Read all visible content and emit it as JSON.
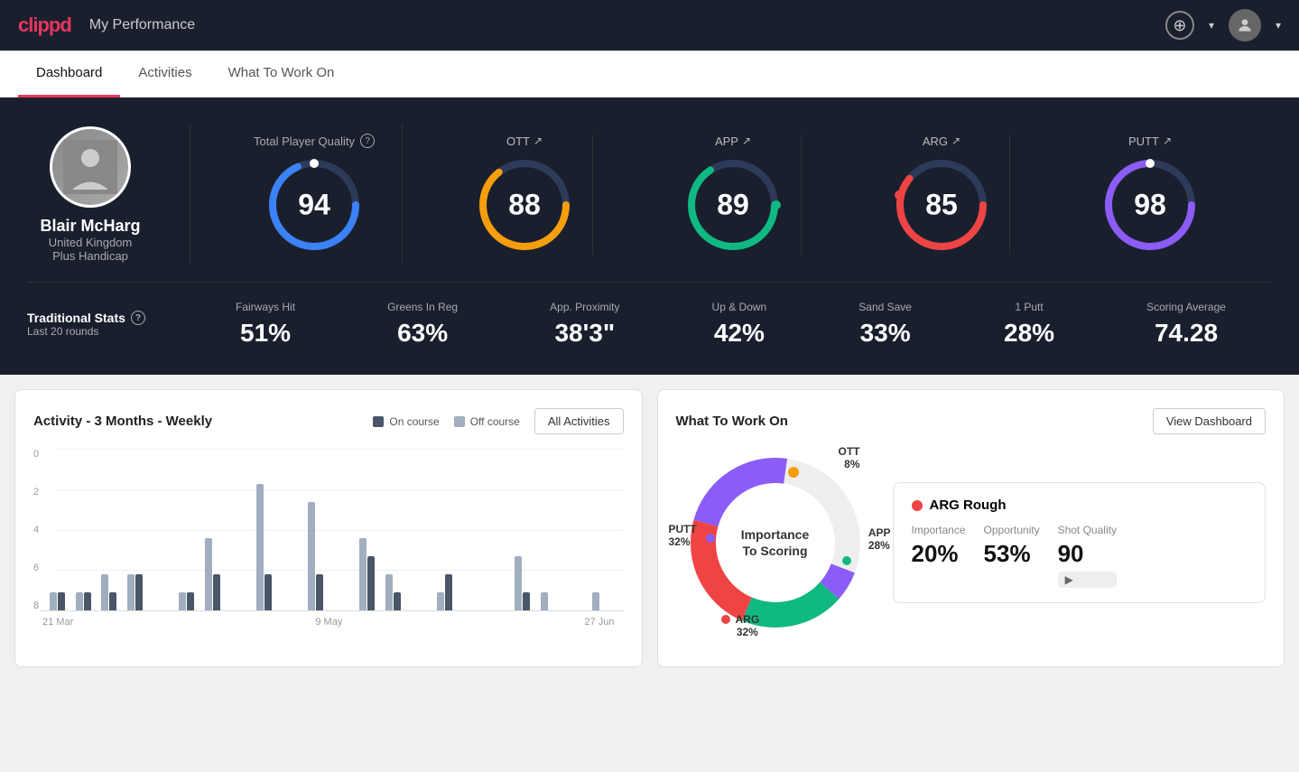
{
  "app": {
    "logo": "clippd",
    "header_title": "My Performance"
  },
  "tabs": [
    {
      "id": "dashboard",
      "label": "Dashboard",
      "active": true
    },
    {
      "id": "activities",
      "label": "Activities",
      "active": false
    },
    {
      "id": "what-to-work-on",
      "label": "What To Work On",
      "active": false
    }
  ],
  "player": {
    "name": "Blair McHarg",
    "country": "United Kingdom",
    "handicap": "Plus Handicap"
  },
  "total_quality": {
    "label": "Total Player Quality",
    "value": 94,
    "color": "#3b82f6"
  },
  "scores": [
    {
      "id": "ott",
      "label": "OTT",
      "value": 88,
      "color": "#f59e0b",
      "trend": "↗"
    },
    {
      "id": "app",
      "label": "APP",
      "value": 89,
      "color": "#10b981",
      "trend": "↗"
    },
    {
      "id": "arg",
      "label": "ARG",
      "value": 85,
      "color": "#ef4444",
      "trend": "↗"
    },
    {
      "id": "putt",
      "label": "PUTT",
      "value": 98,
      "color": "#8b5cf6",
      "trend": "↗"
    }
  ],
  "traditional_stats": {
    "title": "Traditional Stats",
    "period": "Last 20 rounds",
    "stats": [
      {
        "label": "Fairways Hit",
        "value": "51%"
      },
      {
        "label": "Greens In Reg",
        "value": "63%"
      },
      {
        "label": "App. Proximity",
        "value": "38'3\""
      },
      {
        "label": "Up & Down",
        "value": "42%"
      },
      {
        "label": "Sand Save",
        "value": "33%"
      },
      {
        "label": "1 Putt",
        "value": "28%"
      },
      {
        "label": "Scoring Average",
        "value": "74.28"
      }
    ]
  },
  "activity_chart": {
    "title": "Activity - 3 Months - Weekly",
    "legend": [
      {
        "label": "On course",
        "color": "#4a5568"
      },
      {
        "label": "Off course",
        "color": "#a0aec0"
      }
    ],
    "all_activities_btn": "All Activities",
    "y_labels": [
      "0",
      "2",
      "4",
      "6",
      "8"
    ],
    "x_labels": [
      "21 Mar",
      "9 May",
      "27 Jun"
    ],
    "bars": [
      {
        "on": 1,
        "off": 1
      },
      {
        "on": 1,
        "off": 1
      },
      {
        "on": 1,
        "off": 2
      },
      {
        "on": 2,
        "off": 2
      },
      {
        "on": 0,
        "off": 0
      },
      {
        "on": 1,
        "off": 1
      },
      {
        "on": 2,
        "off": 4
      },
      {
        "on": 0,
        "off": 0
      },
      {
        "on": 2,
        "off": 7
      },
      {
        "on": 0,
        "off": 0
      },
      {
        "on": 2,
        "off": 6
      },
      {
        "on": 0,
        "off": 0
      },
      {
        "on": 3,
        "off": 4
      },
      {
        "on": 1,
        "off": 2
      },
      {
        "on": 0,
        "off": 0
      },
      {
        "on": 2,
        "off": 1
      },
      {
        "on": 0,
        "off": 0
      },
      {
        "on": 0,
        "off": 0
      },
      {
        "on": 1,
        "off": 3
      },
      {
        "on": 0,
        "off": 1
      },
      {
        "on": 0,
        "off": 0
      },
      {
        "on": 0,
        "off": 1
      }
    ]
  },
  "what_to_work_on": {
    "title": "What To Work On",
    "view_dashboard_btn": "View Dashboard",
    "donut_label": "Importance\nTo Scoring",
    "segments": [
      {
        "id": "ott",
        "label": "OTT",
        "pct": "8%",
        "color": "#8b5cf6",
        "deg_start": 270,
        "deg_end": 300
      },
      {
        "id": "app",
        "label": "APP",
        "pct": "28%",
        "color": "#10b981",
        "deg_start": 300,
        "deg_end": 390
      },
      {
        "id": "arg",
        "label": "ARG",
        "pct": "32%",
        "color": "#ef4444",
        "deg_start": 390,
        "deg_end": 500
      },
      {
        "id": "putt",
        "label": "PUTT",
        "pct": "32%",
        "color": "#8b5cf6",
        "deg_start": 500,
        "deg_end": 630
      }
    ],
    "detail": {
      "title": "ARG Rough",
      "color": "#ef4444",
      "columns": [
        {
          "label": "Importance",
          "value": "20%"
        },
        {
          "label": "Opportunity",
          "value": "53%"
        },
        {
          "label": "Shot Quality",
          "value": "90",
          "badge": ""
        }
      ]
    }
  }
}
